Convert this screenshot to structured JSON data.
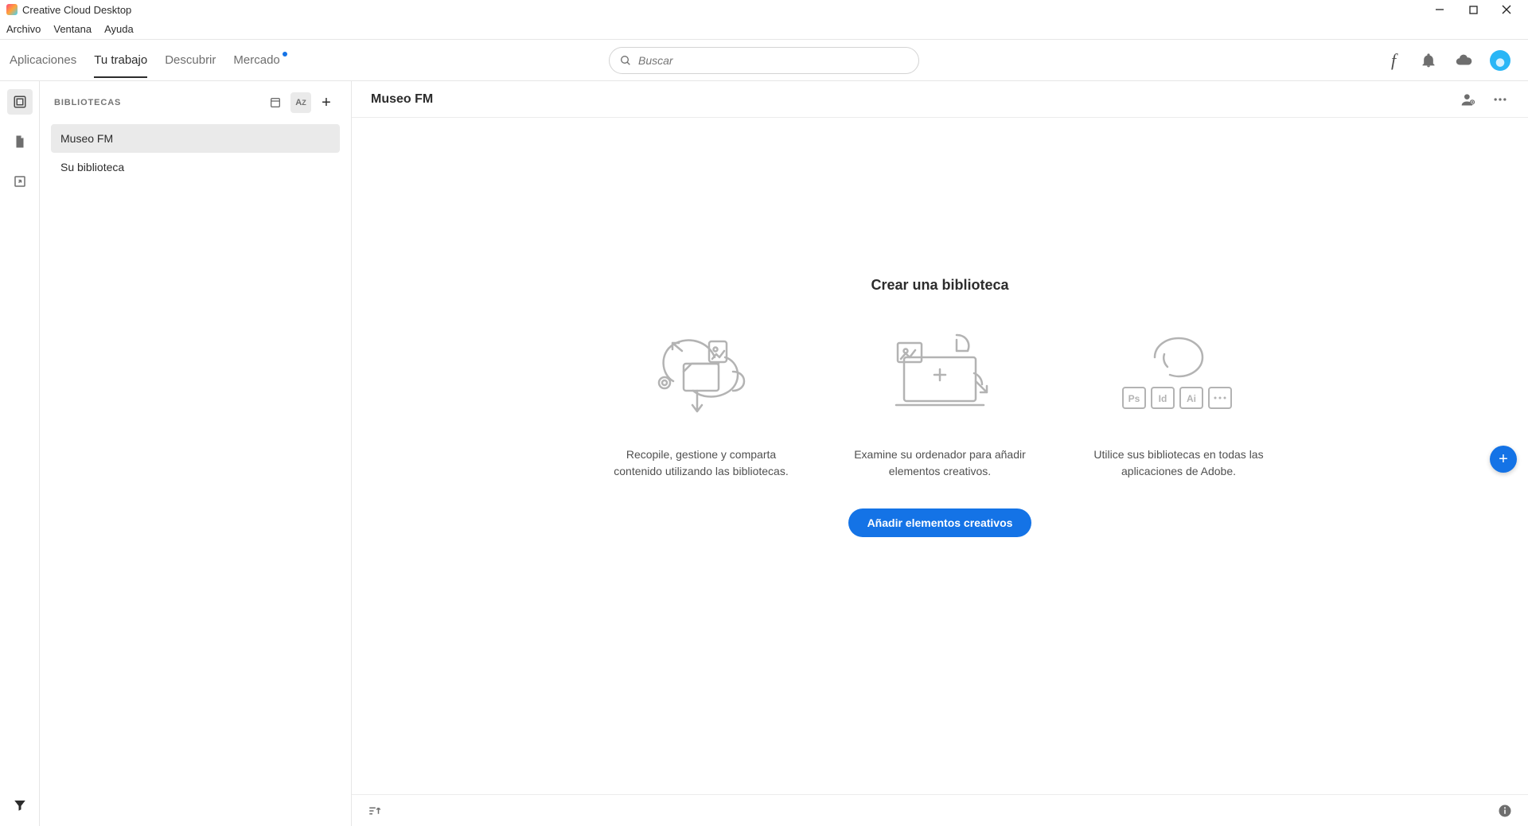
{
  "window": {
    "title": "Creative Cloud Desktop"
  },
  "menu": {
    "archivo": "Archivo",
    "ventana": "Ventana",
    "ayuda": "Ayuda"
  },
  "tabs": {
    "aplicaciones": "Aplicaciones",
    "tu_trabajo": "Tu trabajo",
    "descubrir": "Descubrir",
    "mercado": "Mercado"
  },
  "search": {
    "placeholder": "Buscar"
  },
  "sidebar": {
    "heading": "BIBLIOTECAS",
    "items": [
      {
        "label": "Museo FM",
        "active": true
      },
      {
        "label": "Su biblioteca",
        "active": false
      }
    ]
  },
  "content": {
    "library_name": "Museo FM",
    "empty_title": "Crear una biblioteca",
    "card1": "Recopile, gestione y comparta contenido utilizando las bibliotecas.",
    "card2": "Examine su ordenador para añadir elementos creativos.",
    "card3": "Utilice sus bibliotecas en todas las aplicaciones de Adobe.",
    "cta": "Añadir elementos creativos"
  }
}
